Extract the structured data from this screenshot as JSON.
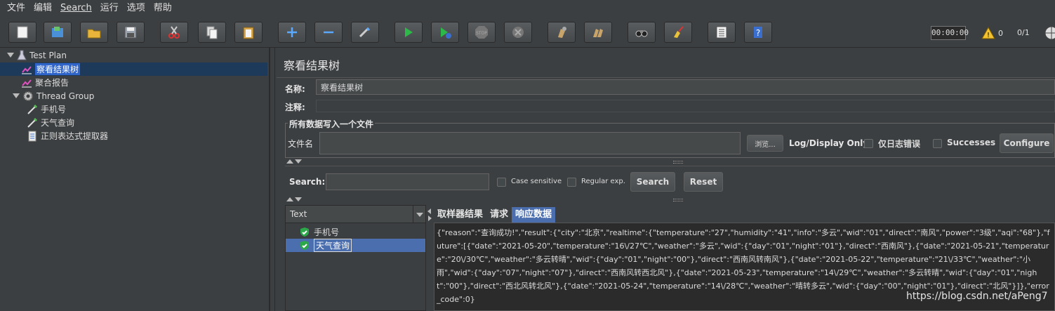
{
  "menu": [
    "文件",
    "编辑",
    "Search",
    "运行",
    "选项",
    "帮助"
  ],
  "toolbar": {
    "timer": "00:00:00",
    "warning_count": "0",
    "threads": "0/1"
  },
  "tree": {
    "test_plan": "Test Plan",
    "view_results_tree": "察看结果树",
    "aggregate_report": "聚合报告",
    "thread_group": "Thread Group",
    "sampler_phone": "手机号",
    "sampler_weather": "天气查询",
    "regex_extractor": "正则表达式提取器"
  },
  "panel": {
    "title": "察看结果树",
    "name_label": "名称:",
    "name_value": "察看结果树",
    "comment_label": "注释:",
    "group_title": "所有数据写入一个文件",
    "filename_label": "文件名",
    "browse_label": "浏览...",
    "log_display_label": "Log/Display Only:",
    "errors_only_label": "仅日志错误",
    "successes_label": "Successes",
    "configure_label": "Configure"
  },
  "search": {
    "label": "Search:",
    "case_sensitive": "Case sensitive",
    "regular_exp": "Regular exp.",
    "search_button": "Search",
    "reset_button": "Reset"
  },
  "results": {
    "renderer": "Text",
    "items": [
      "手机号",
      "天气查询"
    ],
    "tabs": [
      "取样器结果",
      "请求",
      "响应数据"
    ],
    "response_text": "{\"reason\":\"查询成功!\",\"result\":{\"city\":\"北京\",\"realtime\":{\"temperature\":\"27\",\"humidity\":\"41\",\"info\":\"多云\",\"wid\":\"01\",\"direct\":\"南风\",\"power\":\"3级\",\"aqi\":\"68\"},\"future\":[{\"date\":\"2021-05-20\",\"temperature\":\"16\\/27℃\",\"weather\":\"多云\",\"wid\":{\"day\":\"01\",\"night\":\"01\"},\"direct\":\"西南风\"},{\"date\":\"2021-05-21\",\"temperature\":\"20\\/30℃\",\"weather\":\"多云转晴\",\"wid\":{\"day\":\"01\",\"night\":\"00\"},\"direct\":\"西南风转南风\"},{\"date\":\"2021-05-22\",\"temperature\":\"21\\/33℃\",\"weather\":\"小雨\",\"wid\":{\"day\":\"07\",\"night\":\"07\"},\"direct\":\"西南风转西北风\"},{\"date\":\"2021-05-23\",\"temperature\":\"14\\/29℃\",\"weather\":\"多云转晴\",\"wid\":{\"day\":\"01\",\"night\":\"00\"},\"direct\":\"西北风转北风\"},{\"date\":\"2021-05-24\",\"temperature\":\"14\\/28℃\",\"weather\":\"晴转多云\",\"wid\":{\"day\":\"00\",\"night\":\"01\"},\"direct\":\"北风\"}]},\"error_code\":0}"
  },
  "watermark": "https://blog.csdn.net/aPeng7"
}
